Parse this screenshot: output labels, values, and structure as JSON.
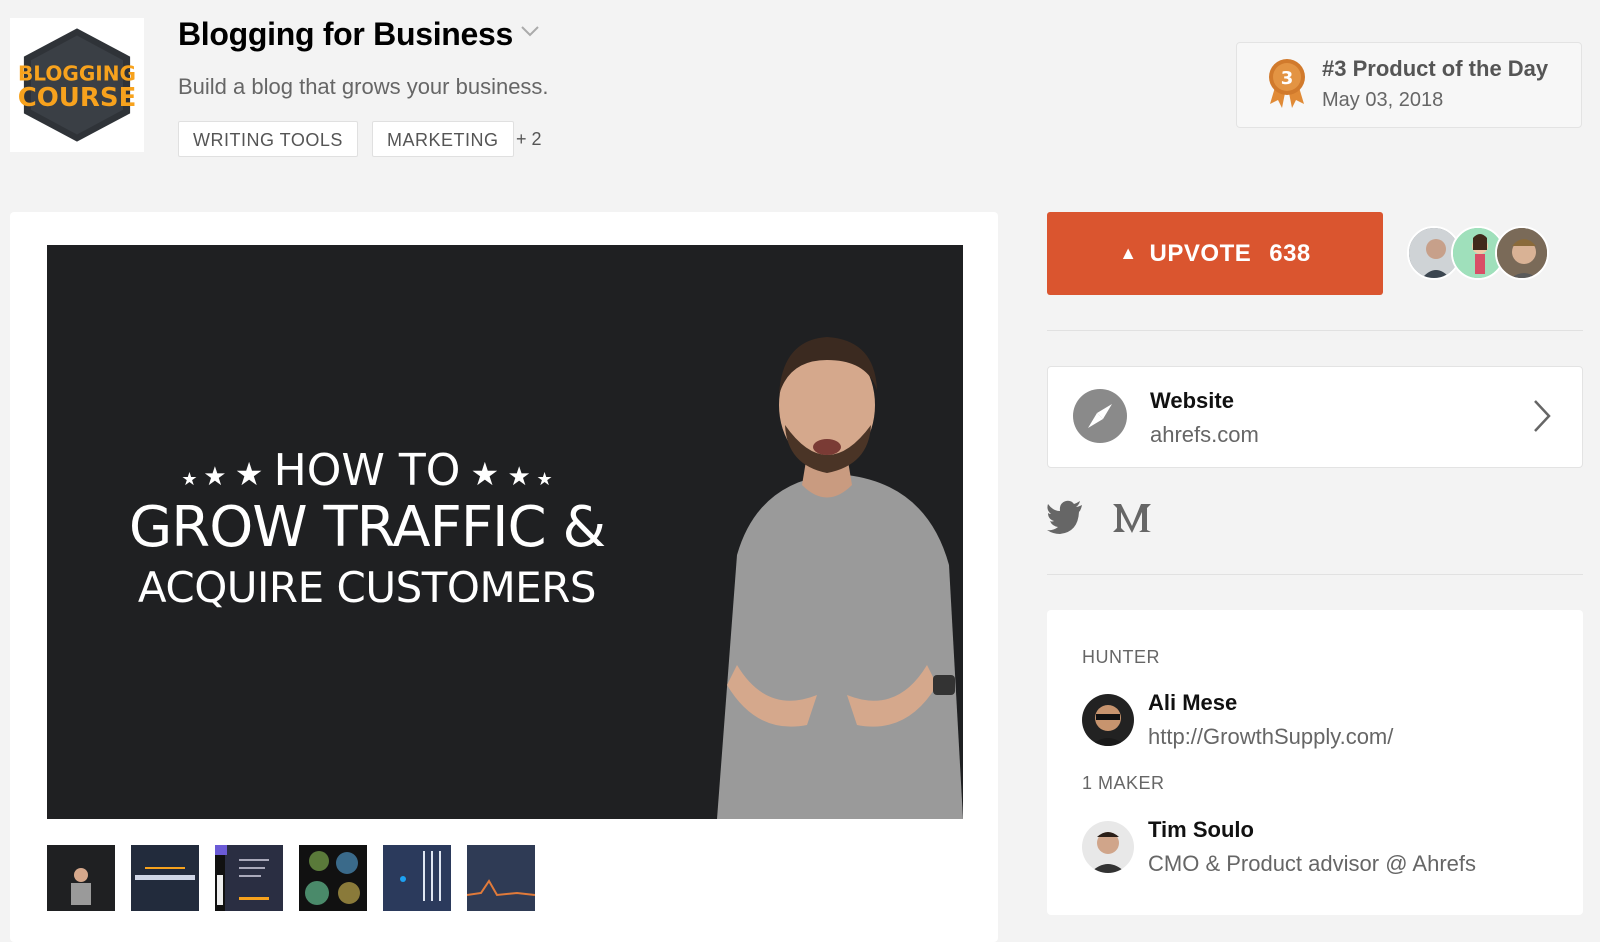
{
  "product": {
    "logo_text_line1": "BLOGGING",
    "logo_text_line2": "COURSE",
    "title": "Blogging for Business",
    "tagline": "Build a blog that grows your business.",
    "tags": [
      "WRITING TOOLS",
      "MARKETING"
    ],
    "more_tags": "+ 2"
  },
  "badge": {
    "rank_number": "3",
    "title": "#3 Product of the Day",
    "date": "May 03, 2018"
  },
  "video": {
    "line1": "HOW TO",
    "line2": "GROW TRAFFIC &",
    "line3": "ACQUIRE CUSTOMERS",
    "thumbnail_count": 6
  },
  "upvote": {
    "label": "UPVOTE",
    "count": "638"
  },
  "website": {
    "label": "Website",
    "url": "ahrefs.com"
  },
  "social": [
    "twitter-icon",
    "medium-icon"
  ],
  "people": {
    "hunter_heading": "HUNTER",
    "hunter": {
      "name": "Ali Mese",
      "desc": "http://GrowthSupply.com/"
    },
    "maker_heading": "1 MAKER",
    "maker": {
      "name": "Tim Soulo",
      "desc": "CMO & Product advisor @ Ahrefs"
    }
  },
  "colors": {
    "accent": "#da552f",
    "medal": "#cc7a30",
    "background": "#f3f3f3"
  }
}
